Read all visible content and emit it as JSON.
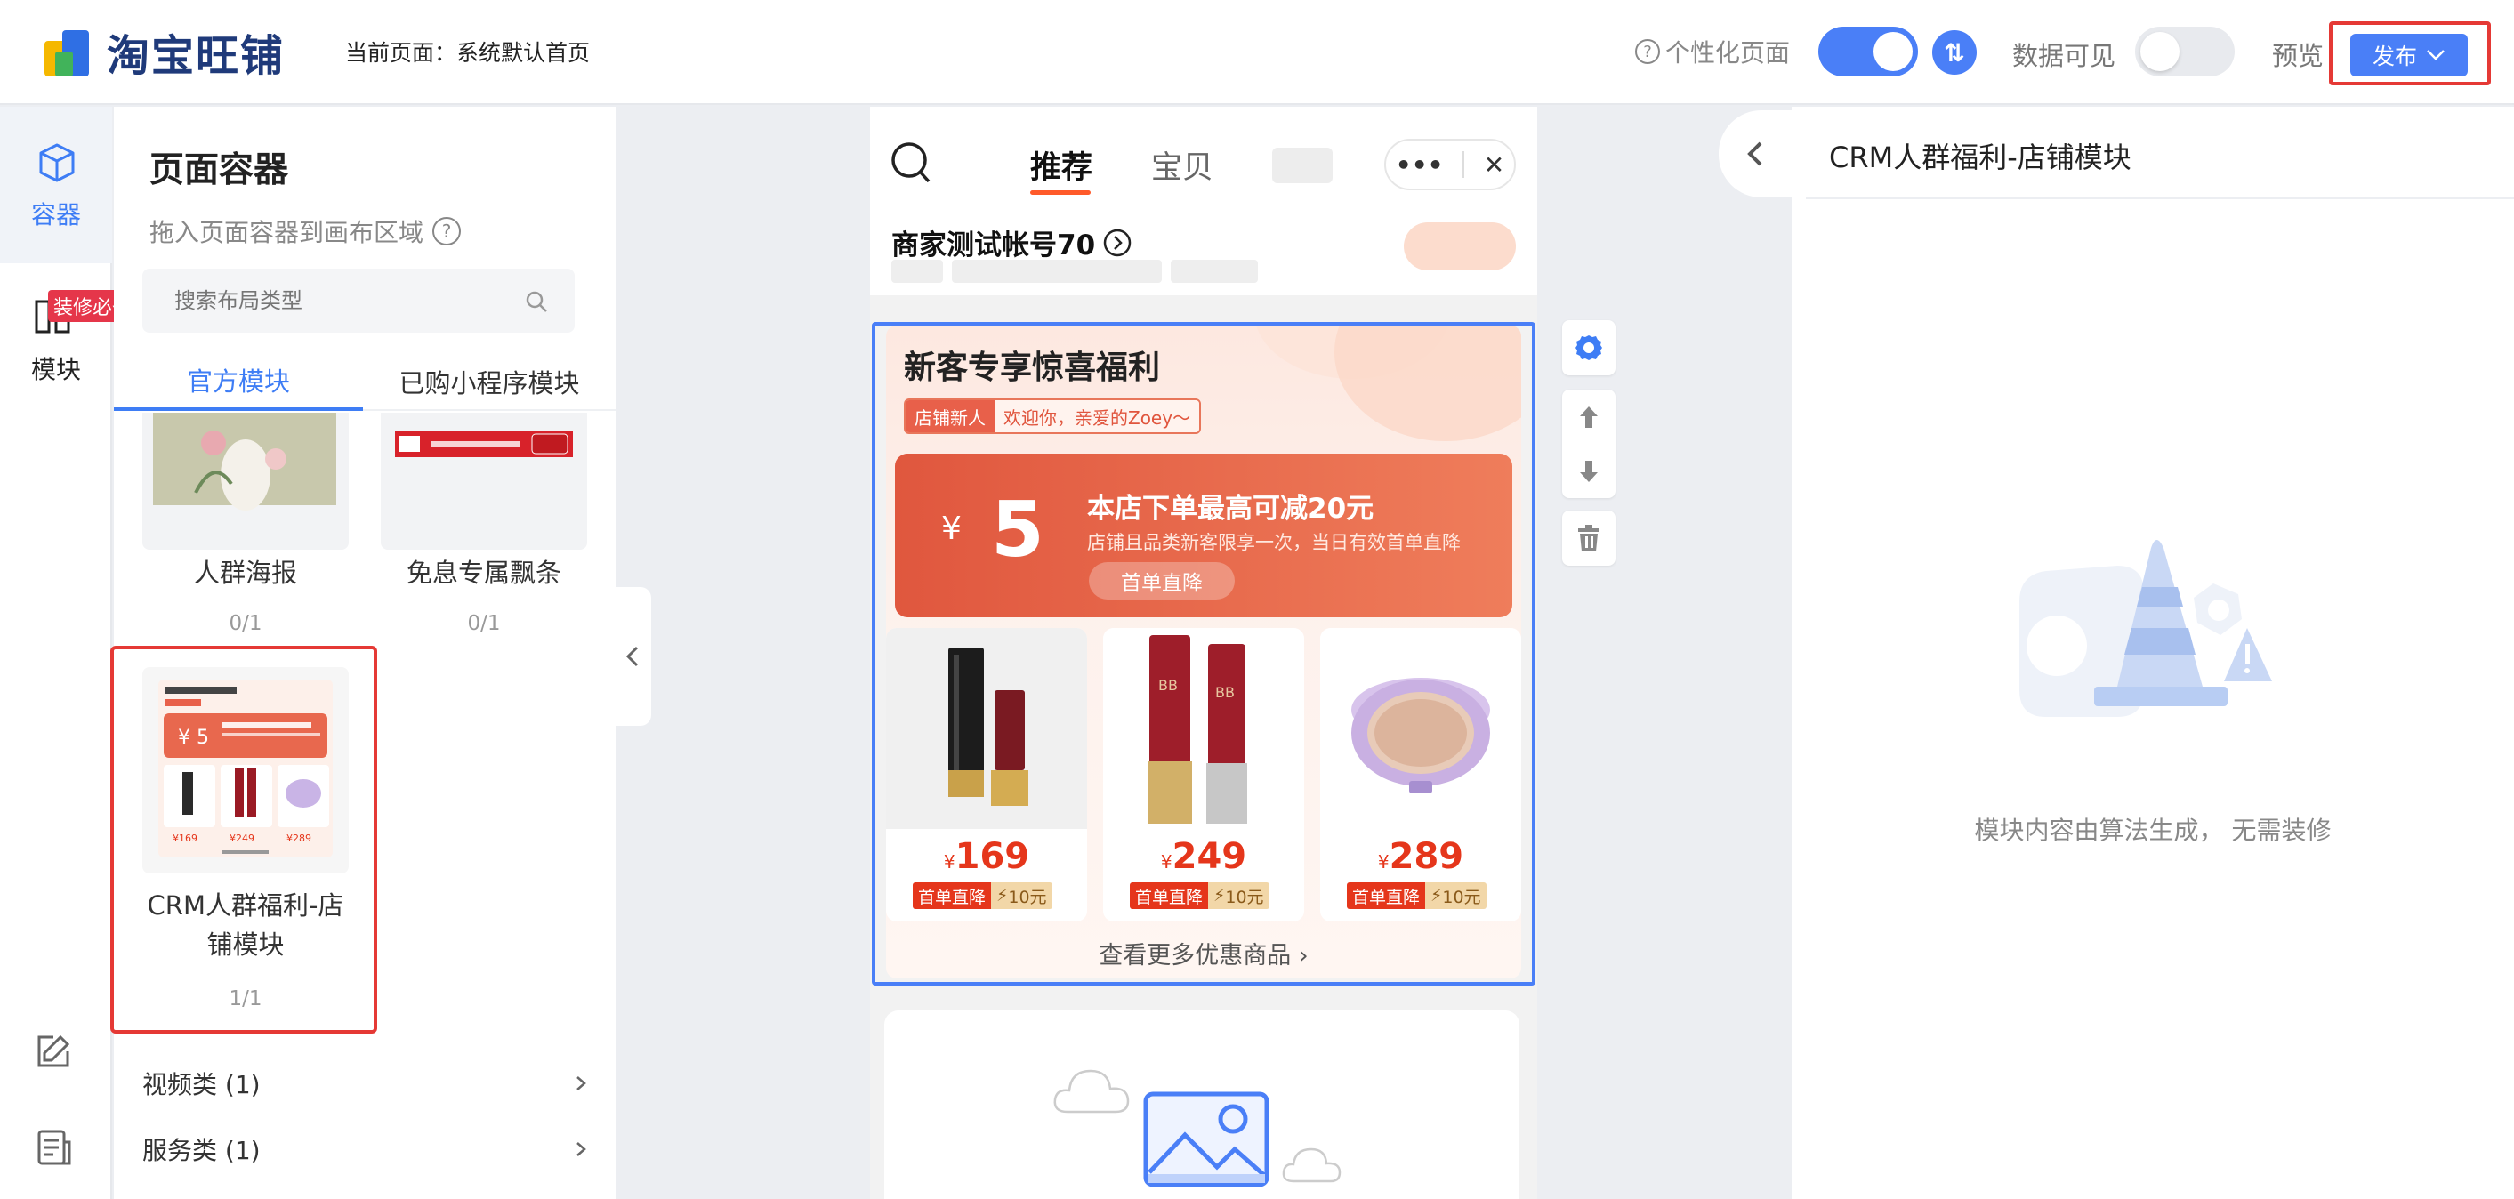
{
  "header": {
    "logo_text": "淘宝旺铺",
    "current_page_label": "当前页面：系统默认首页",
    "personalize_label": "个性化页面",
    "data_visible_label": "数据可见",
    "preview_label": "预览",
    "publish_label": "发布"
  },
  "rail": {
    "items": [
      {
        "label": "容器"
      },
      {
        "label": "模块"
      }
    ],
    "badge": "装修必备"
  },
  "panel": {
    "title": "页面容器",
    "subtitle": "拖入页面容器到画布区域",
    "search_placeholder": "搜索布局类型",
    "tabs": [
      {
        "label": "官方模块"
      },
      {
        "label": "已购小程序模块"
      }
    ],
    "cards": [
      {
        "name": "人群海报",
        "count": "0/1"
      },
      {
        "name": "免息专属飘条",
        "count": "0/1"
      },
      {
        "name": "CRM人群福利-店铺模块",
        "name_line1": "CRM人群福利-店",
        "name_line2": "铺模块",
        "count": "1/1"
      }
    ],
    "categories": [
      {
        "label": "视频类  (1)"
      },
      {
        "label": "服务类  (1)"
      }
    ]
  },
  "phone": {
    "tabs": [
      {
        "label": "推荐"
      },
      {
        "label": "宝贝"
      }
    ],
    "shop_name": "商家测试帐号70",
    "crm": {
      "title": "新客专享惊喜福利",
      "tag_new": "店铺新人",
      "greeting": "欢迎你，亲爱的Zoey～",
      "coupon_yen": "¥",
      "coupon_amount": "5",
      "coupon_title": "本店下单最高可减20元",
      "coupon_desc": "店铺且品类新客限享一次，当日有效首单直降",
      "coupon_btn": "首单直降",
      "products": [
        {
          "yen": "¥",
          "price": "169",
          "tag1": "首单直降",
          "tag2": "10元"
        },
        {
          "yen": "¥",
          "price": "249",
          "tag1": "首单直降",
          "tag2": "10元"
        },
        {
          "yen": "¥",
          "price": "289",
          "tag1": "首单直降",
          "tag2": "10元"
        }
      ],
      "more_link": "查看更多优惠商品 ›"
    }
  },
  "right_panel": {
    "title": "CRM人群福利-店铺模块",
    "empty_text": "模块内容由算法生成，  无需装修"
  },
  "colors": {
    "accent": "#4a7ff7",
    "highlight": "#e53935",
    "price": "#e5361b"
  }
}
